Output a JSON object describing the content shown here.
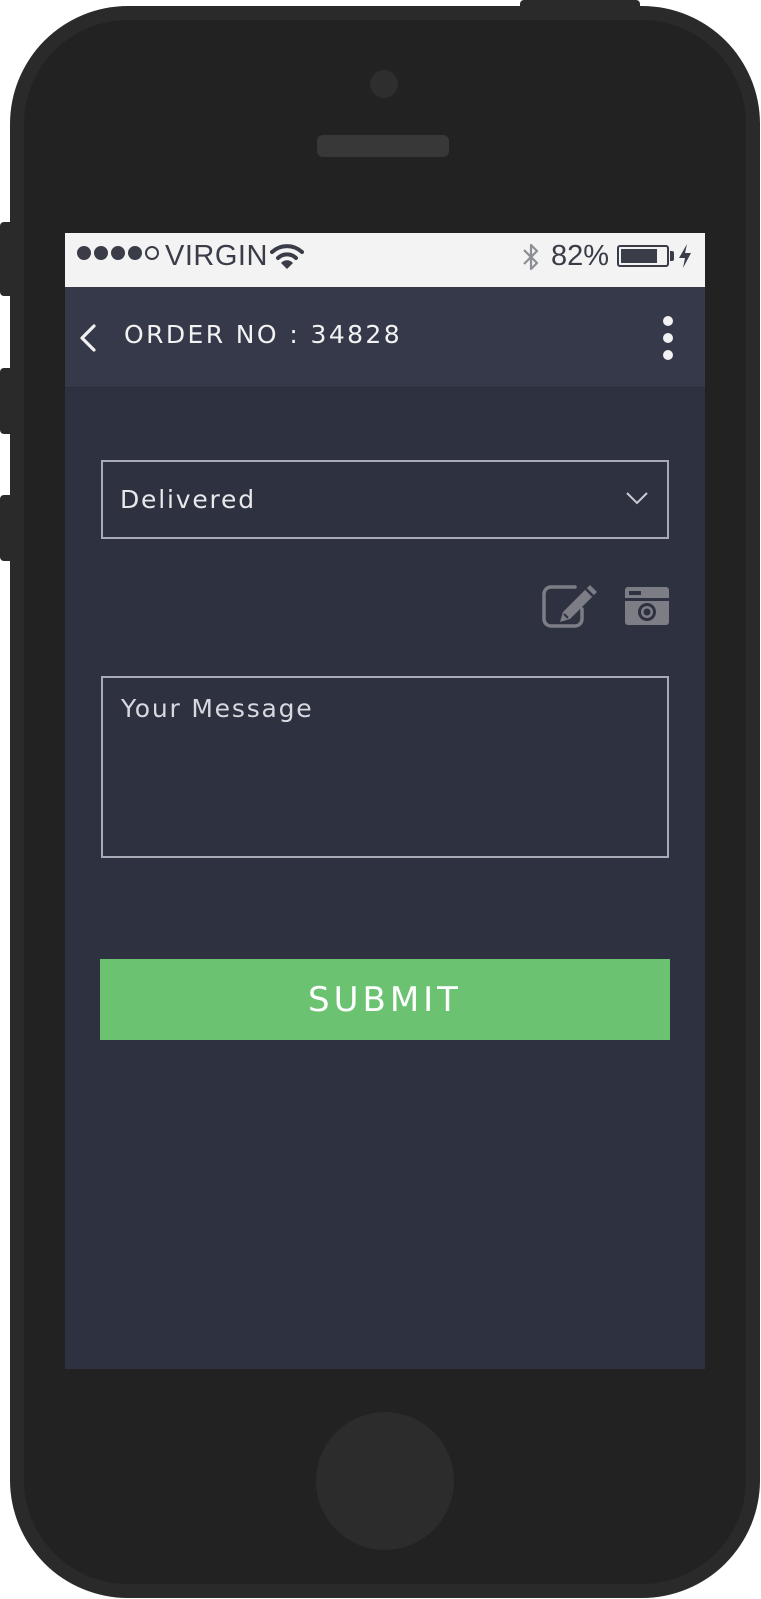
{
  "status_bar": {
    "carrier": "VIRGIN",
    "signal_bars_filled": 4,
    "signal_bars_total": 5,
    "battery_percent_label": "82%",
    "battery_level": 0.82,
    "icons": [
      "wifi-icon",
      "bluetooth-icon",
      "battery-icon",
      "charging-icon"
    ]
  },
  "app_bar": {
    "title": "ORDER NO : 34828",
    "back_icon": "chevron-left-icon",
    "menu_icon": "more-vertical-icon"
  },
  "form": {
    "status_select": {
      "selected_value": "Delivered",
      "icon": "chevron-down-icon"
    },
    "actions": {
      "edit_icon": "edit-icon",
      "camera_icon": "camera-icon"
    },
    "message": {
      "value": "",
      "placeholder": "Your Message"
    },
    "submit_label": "SUBMIT"
  },
  "colors": {
    "screen_background": "#2e3140",
    "app_bar_background": "#363949",
    "status_bar_background": "#f3f3f3",
    "submit_button": "#6bc271",
    "input_border": "#a8abb6",
    "icon_gray": "#7d7e85"
  }
}
